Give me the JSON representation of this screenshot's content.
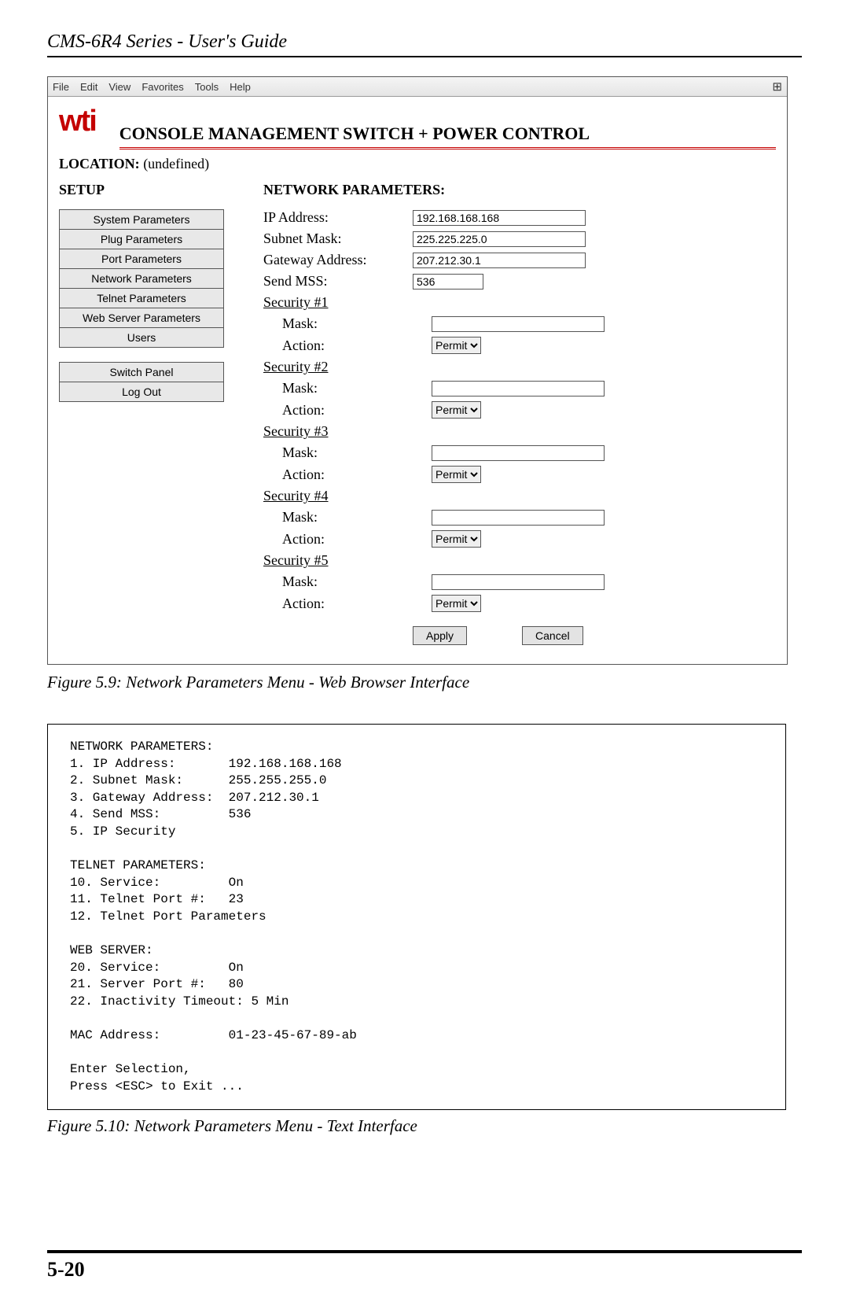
{
  "doc_title": "CMS-6R4 Series - User's Guide",
  "menubar": [
    "File",
    "Edit",
    "View",
    "Favorites",
    "Tools",
    "Help"
  ],
  "win_icon": "⊞",
  "logo_text": "wti",
  "header_title": "CONSOLE MANAGEMENT SWITCH + POWER CONTROL",
  "location_label": "LOCATION:",
  "location_value": "(undefined)",
  "setup_label": "SETUP",
  "sidebar_group1": [
    "System Parameters",
    "Plug Parameters",
    "Port Parameters",
    "Network Parameters",
    "Telnet Parameters",
    "Web Server Parameters",
    "Users"
  ],
  "sidebar_group2": [
    "Switch Panel",
    "Log Out"
  ],
  "form_title": "NETWORK PARAMETERS:",
  "ip_label": "IP Address:",
  "ip_value": "192.168.168.168",
  "subnet_label": "Subnet Mask:",
  "subnet_value": "225.225.225.0",
  "gateway_label": "Gateway Address:",
  "gateway_value": "207.212.30.1",
  "mss_label": "Send MSS:",
  "mss_value": "536",
  "security": [
    {
      "title": "Security #1",
      "mask_label": "Mask:",
      "mask_value": "",
      "action_label": "Action:",
      "action_value": "Permit"
    },
    {
      "title": "Security #2",
      "mask_label": "Mask:",
      "mask_value": "",
      "action_label": "Action:",
      "action_value": "Permit"
    },
    {
      "title": "Security #3",
      "mask_label": "Mask:",
      "mask_value": "",
      "action_label": "Action:",
      "action_value": "Permit"
    },
    {
      "title": "Security #4",
      "mask_label": "Mask:",
      "mask_value": "",
      "action_label": "Action:",
      "action_value": "Permit"
    },
    {
      "title": "Security #5",
      "mask_label": "Mask:",
      "mask_value": "",
      "action_label": "Action:",
      "action_value": "Permit"
    }
  ],
  "apply_label": "Apply",
  "cancel_label": "Cancel",
  "caption1": "Figure 5.9:  Network Parameters Menu - Web Browser Interface",
  "terminal_text": "NETWORK PARAMETERS:\n1. IP Address:       192.168.168.168\n2. Subnet Mask:      255.255.255.0\n3. Gateway Address:  207.212.30.1\n4. Send MSS:         536\n5. IP Security\n\nTELNET PARAMETERS:\n10. Service:         On\n11. Telnet Port #:   23\n12. Telnet Port Parameters\n\nWEB SERVER:\n20. Service:         On\n21. Server Port #:   80\n22. Inactivity Timeout: 5 Min\n\nMAC Address:         01-23-45-67-89-ab\n\nEnter Selection,\nPress <ESC> to Exit ...",
  "caption2": "Figure 5.10:  Network Parameters Menu - Text Interface",
  "page_number": "5-20"
}
